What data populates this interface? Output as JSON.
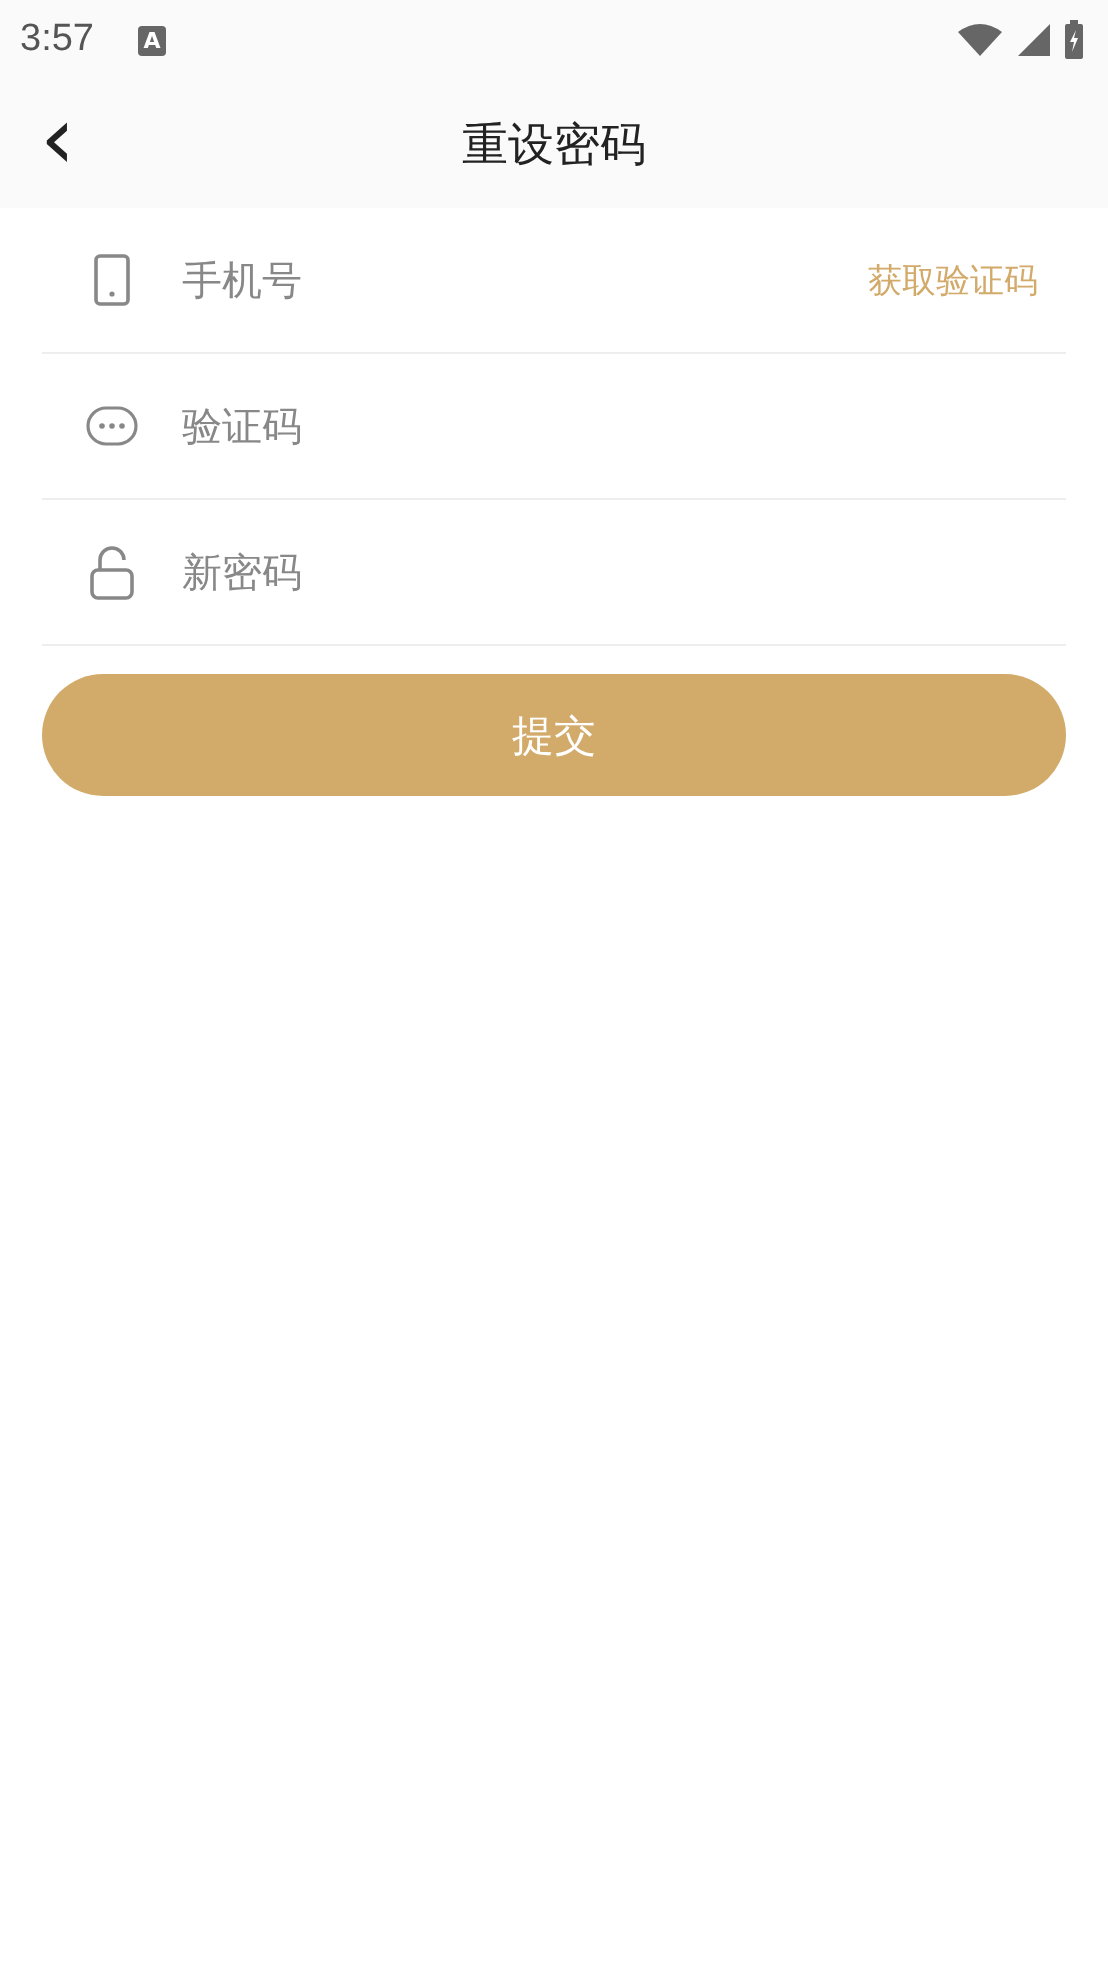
{
  "status_bar": {
    "time": "3:57",
    "notification_glyph": "A"
  },
  "header": {
    "back_glyph": "‹",
    "title": "重设密码"
  },
  "fields": [
    {
      "kind": "phone",
      "placeholder": "手机号",
      "action": "获取验证码"
    },
    {
      "kind": "chat",
      "placeholder": "验证码"
    },
    {
      "kind": "lock",
      "placeholder": "新密码"
    }
  ],
  "submit": {
    "label": "提交"
  }
}
